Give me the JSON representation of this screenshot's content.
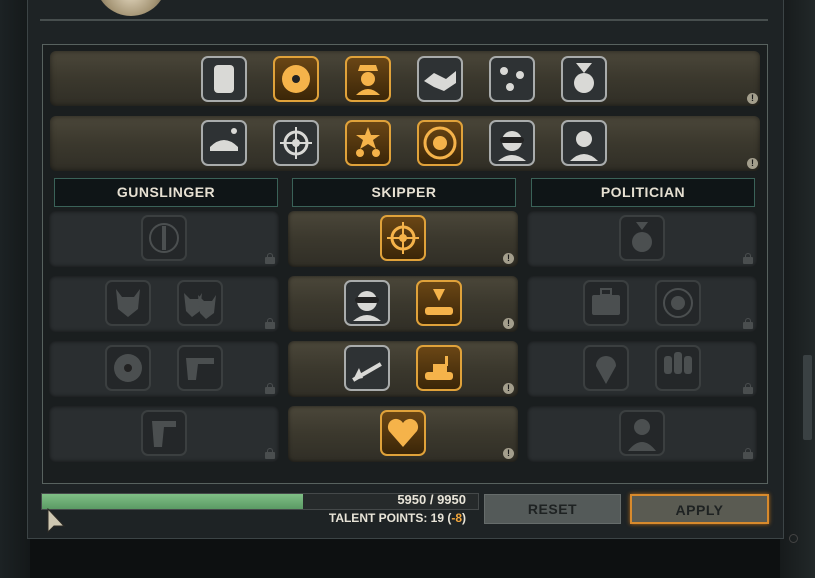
{
  "rows": [
    {
      "icons": [
        "pins-icon",
        "revolver-cylinder-icon",
        "officer-portrait-icon",
        "handshake-icon",
        "map-pins-icon",
        "medal-icon"
      ],
      "states": [
        "white",
        "gold",
        "gold",
        "white",
        "white",
        "white"
      ]
    },
    {
      "icons": [
        "singing-cap-icon",
        "ship-wheel-icon",
        "soldiers-star-icon",
        "laurel-fist-icon",
        "goggles-soldier-icon",
        "shining-politician-icon"
      ],
      "states": [
        "white",
        "white",
        "gold",
        "gold",
        "white",
        "white"
      ]
    }
  ],
  "trees": [
    {
      "name": "GUNSLINGER",
      "tiers": [
        {
          "icons": [
            "gun-sight-icon"
          ],
          "states": [
            "locked"
          ]
        },
        {
          "icons": [
            "wolf-head-icon",
            "wolf-pack-icon"
          ],
          "states": [
            "locked",
            "locked"
          ]
        },
        {
          "icons": [
            "revolver-cylinder-icon",
            "pistol-icon"
          ],
          "states": [
            "locked",
            "locked"
          ]
        },
        {
          "icons": [
            "pistol-side-icon"
          ],
          "states": [
            "locked"
          ]
        }
      ]
    },
    {
      "name": "SKIPPER",
      "tiers": [
        {
          "icons": [
            "ship-wheel-icon"
          ],
          "states": [
            "gold"
          ]
        },
        {
          "icons": [
            "goggles-soldier-icon",
            "tank-explosion-icon"
          ],
          "states": [
            "white",
            "gold"
          ]
        },
        {
          "icons": [
            "rifle-fire-icon",
            "tank-icon"
          ],
          "states": [
            "white",
            "gold"
          ]
        },
        {
          "icons": [
            "heartbeat-icon"
          ],
          "states": [
            "gold"
          ]
        }
      ]
    },
    {
      "name": "POLITICIAN",
      "tiers": [
        {
          "icons": [
            "star-medal-icon"
          ],
          "states": [
            "locked"
          ]
        },
        {
          "icons": [
            "briefcase-icon",
            "punch-target-icon"
          ],
          "states": [
            "locked",
            "locked"
          ]
        },
        {
          "icons": [
            "map-pin-icon",
            "raised-fists-icon"
          ],
          "states": [
            "locked",
            "locked"
          ]
        },
        {
          "icons": [
            "bust-icon"
          ],
          "states": [
            "locked"
          ]
        }
      ]
    }
  ],
  "xp": {
    "current": 5950,
    "max": 9950,
    "label": "5950 / 9950"
  },
  "talent": {
    "label": "TALENT POINTS: 19 (",
    "delta": "-8",
    "close": ")"
  },
  "buttons": {
    "reset": "RESET",
    "apply": "APPLY"
  },
  "colors": {
    "gold": "#e0a23a",
    "xp": "#6aa873",
    "header_border": "#3a6258"
  }
}
